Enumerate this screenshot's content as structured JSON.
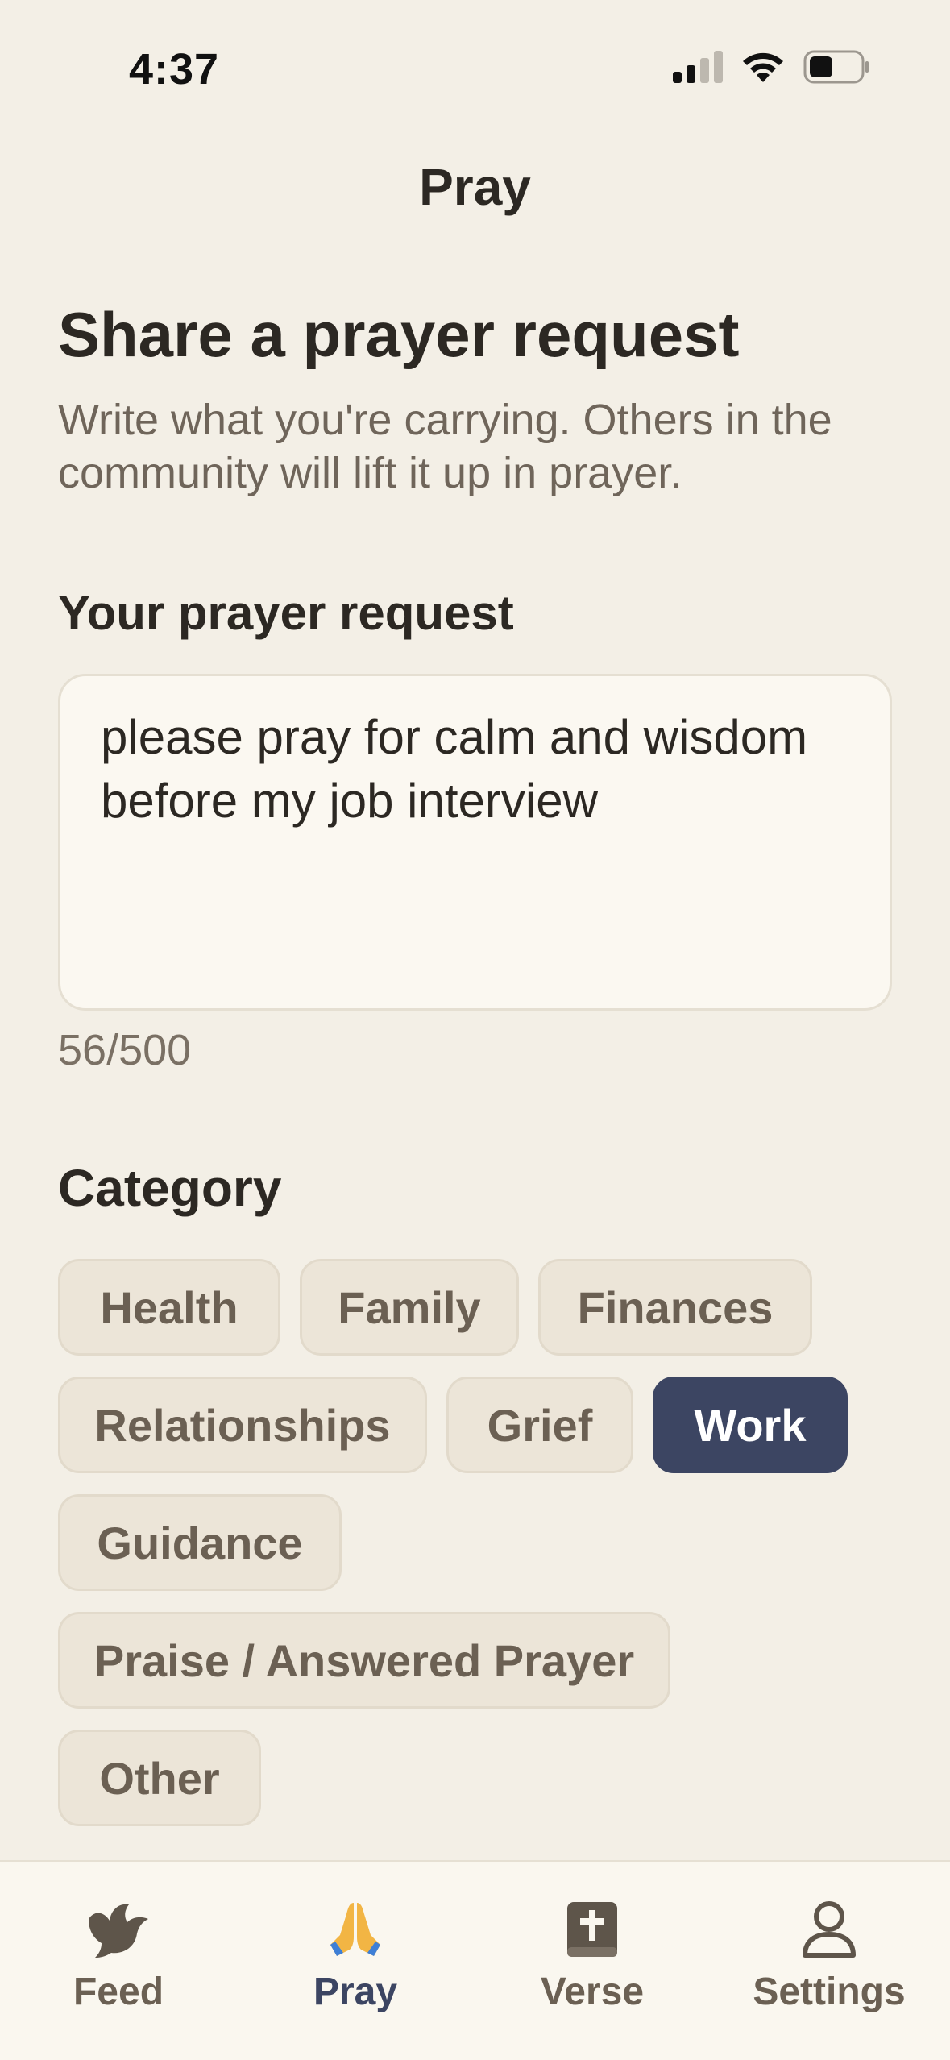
{
  "status_bar": {
    "time": "4:37"
  },
  "nav": {
    "title": "Pray"
  },
  "form": {
    "headline": "Share a prayer request",
    "subtext": "Write what you're carrying. Others in the community will lift it up in prayer.",
    "request_label": "Your prayer request",
    "request_value": "please pray for calm and wisdom before my job interview",
    "char_count": "56/500",
    "category_label": "Category",
    "categories": [
      {
        "label": "Health",
        "selected": false
      },
      {
        "label": "Family",
        "selected": false
      },
      {
        "label": "Finances",
        "selected": false
      },
      {
        "label": "Relationships",
        "selected": false
      },
      {
        "label": "Grief",
        "selected": false
      },
      {
        "label": "Work",
        "selected": true
      },
      {
        "label": "Guidance",
        "selected": false
      },
      {
        "label": "Praise / Answered Prayer",
        "selected": false
      },
      {
        "label": "Other",
        "selected": false
      }
    ]
  },
  "tab_bar": {
    "tabs": [
      {
        "label": "Feed",
        "icon": "dove-icon",
        "active": false
      },
      {
        "label": "Pray",
        "icon": "praying-hands-icon",
        "active": true
      },
      {
        "label": "Verse",
        "icon": "bible-icon",
        "active": false
      },
      {
        "label": "Settings",
        "icon": "person-icon",
        "active": false
      }
    ]
  },
  "colors": {
    "background": "#F3EFE6",
    "accent": "#3C4562",
    "chip_background": "#ECE5D8",
    "text_primary": "#2C2823",
    "text_secondary": "#6F655A"
  }
}
